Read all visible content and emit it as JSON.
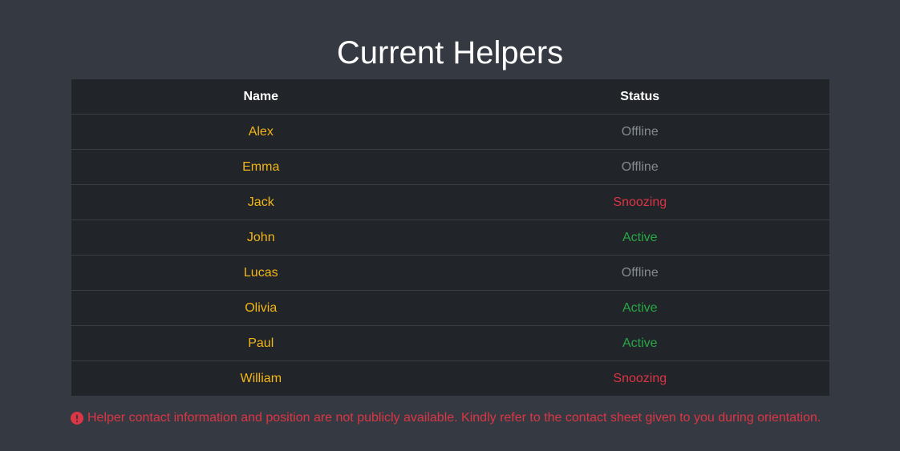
{
  "page": {
    "title": "Current Helpers"
  },
  "table": {
    "headers": {
      "name": "Name",
      "status": "Status"
    },
    "rows": [
      {
        "name": "Alex",
        "status": "Offline",
        "status_type": "offline"
      },
      {
        "name": "Emma",
        "status": "Offline",
        "status_type": "offline"
      },
      {
        "name": "Jack",
        "status": "Snoozing",
        "status_type": "snoozing"
      },
      {
        "name": "John",
        "status": "Active",
        "status_type": "active"
      },
      {
        "name": "Lucas",
        "status": "Offline",
        "status_type": "offline"
      },
      {
        "name": "Olivia",
        "status": "Active",
        "status_type": "active"
      },
      {
        "name": "Paul",
        "status": "Active",
        "status_type": "active"
      },
      {
        "name": "William",
        "status": "Snoozing",
        "status_type": "snoozing"
      }
    ]
  },
  "notice": {
    "icon": "exclamation-circle-icon",
    "text": "Helper contact information and position are not publicly available. Kindly refer to the contact sheet given to you during orientation."
  },
  "colors": {
    "background": "#353a42",
    "table_background": "#212429",
    "name": "#f2b616",
    "offline": "#858b91",
    "snoozing": "#dc3545",
    "active": "#28a745"
  }
}
